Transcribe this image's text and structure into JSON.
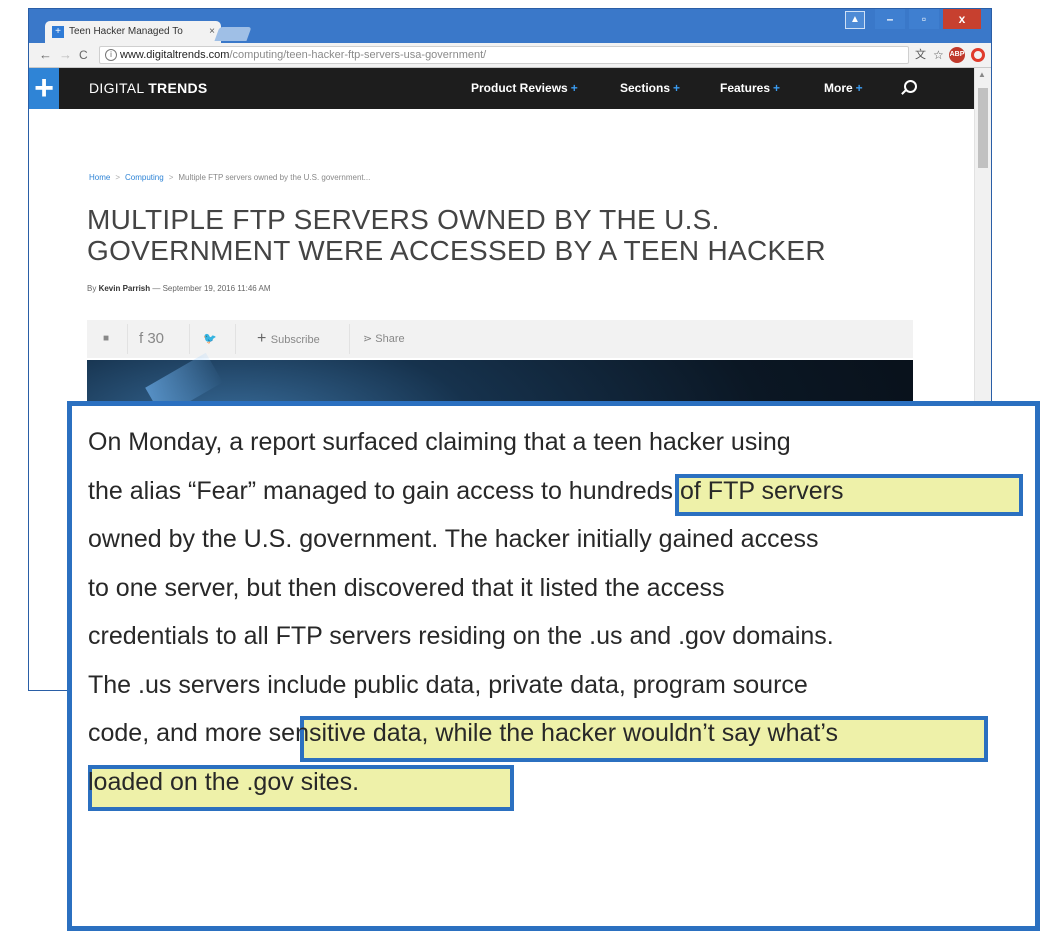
{
  "browser": {
    "tab_title": "Teen Hacker Managed To",
    "tab_close": "×",
    "url_host": "www.digitaltrends.com",
    "url_path": "/computing/teen-hacker-ftp-servers-usa-government/",
    "window_controls": {
      "minimize": "–",
      "maximize": "▫",
      "close": "x"
    }
  },
  "site": {
    "brand_light": "DIGITAL ",
    "brand_bold": "TRENDS",
    "nav": [
      {
        "label": "Product Reviews"
      },
      {
        "label": "Sections"
      },
      {
        "label": "Features"
      },
      {
        "label": "More"
      }
    ],
    "nav_plus": "+"
  },
  "article": {
    "breadcrumb": [
      "Home",
      "Computing",
      "Multiple FTP servers owned by the U.S. government..."
    ],
    "breadcrumb_sep": ">",
    "headline": "MULTIPLE FTP SERVERS OWNED BY THE U.S. GOVERNMENT WERE ACCESSED BY A TEEN HACKER",
    "byline_prefix": "By ",
    "author": "Kevin Parrish",
    "date": " — September 19, 2016 11:46 AM",
    "share": {
      "facebook_count": "30",
      "subscribe": "Subscribe",
      "share": "Share"
    }
  },
  "callout": {
    "lines": [
      "On Monday, a report surfaced claiming that a teen hacker using",
      "the alias “Fear” managed to gain access to hundreds of FTP servers",
      "owned by the U.S. government. The hacker initially gained access",
      "to one server, but then discovered that it listed the access",
      "credentials to all FTP servers residing on the .us and .gov domains.",
      "The .us servers include public data, private data, program source",
      "code, and more sensitive data, while the hacker wouldn’t say what’s",
      "loaded on the .gov sites."
    ],
    "highlights": [
      "hundreds of FTP servers",
      "include public data, private data, program source",
      "code, and more sensitive data,"
    ]
  }
}
